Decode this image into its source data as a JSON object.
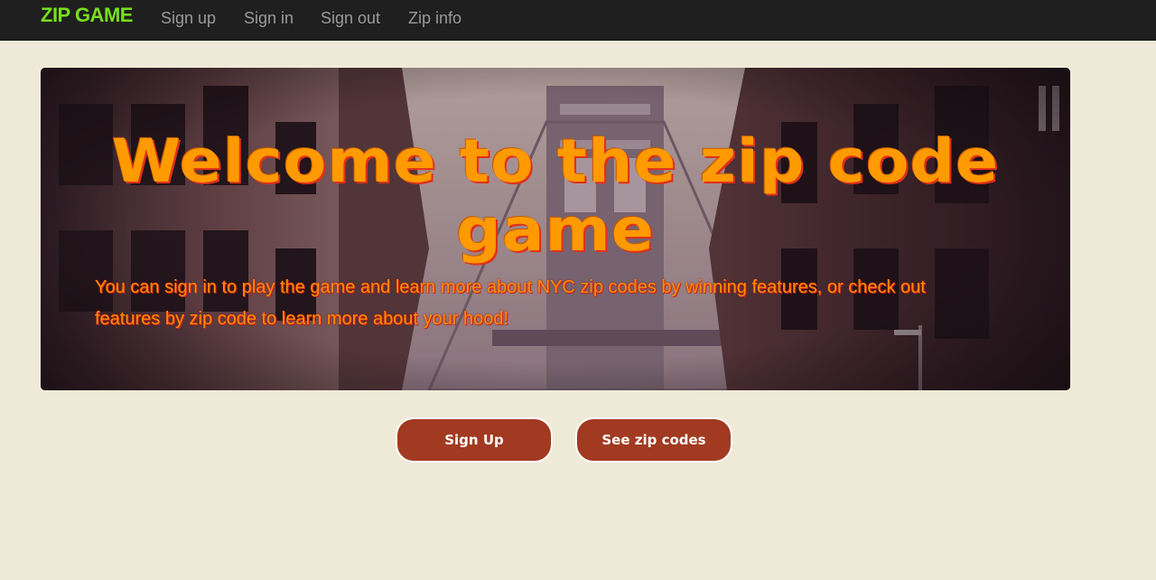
{
  "navbar": {
    "brand": "ZIP GAME",
    "links": [
      "Sign up",
      "Sign in",
      "Sign out",
      "Zip info"
    ]
  },
  "hero": {
    "title": "Welcome to the zip code game",
    "text": "You can sign in to play the game and learn more about NYC zip codes by winning features, or check out features by zip code to learn more about your hood!"
  },
  "buttons": {
    "sign_up": "Sign Up",
    "see_zip_codes": "See zip codes"
  },
  "colors": {
    "brand": "#76e01a",
    "navbar_bg": "#1f1f1f",
    "page_bg": "#efead8",
    "hero_title": "#ff9a00",
    "button_bg": "#a13a20"
  }
}
